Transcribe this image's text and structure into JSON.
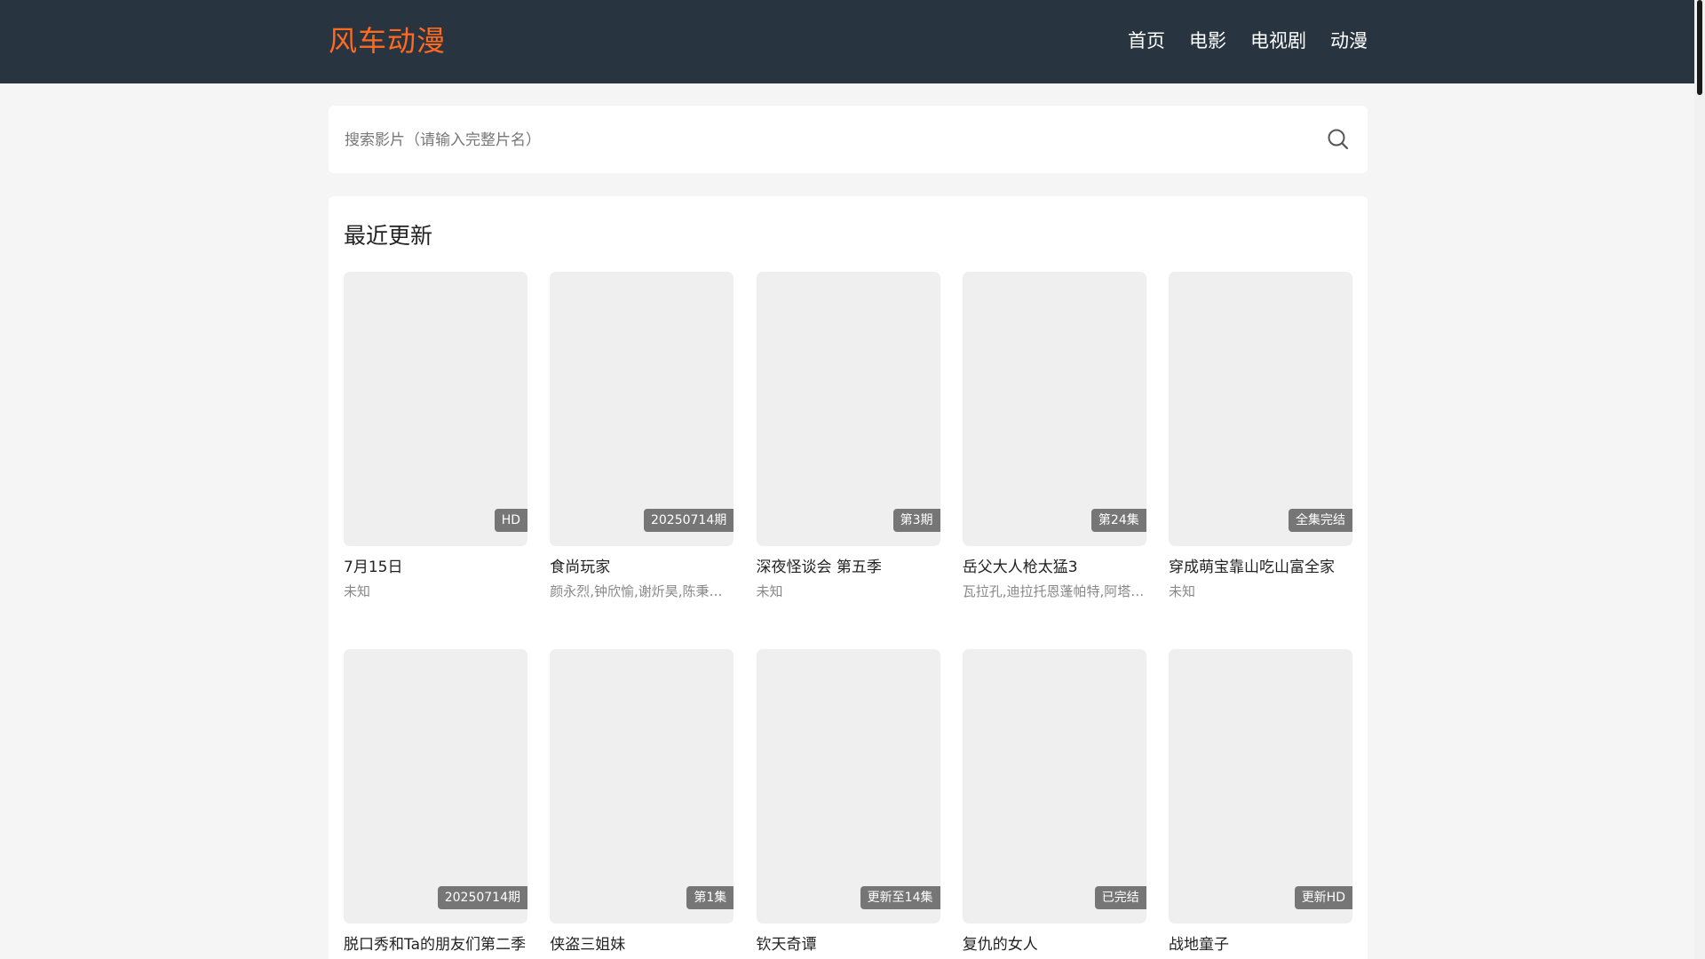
{
  "header": {
    "logo": "风车动漫",
    "nav": [
      "首页",
      "电影",
      "电视剧",
      "动漫"
    ]
  },
  "search": {
    "placeholder": "搜索影片（请输入完整片名）",
    "value": ""
  },
  "section": {
    "title": "最近更新"
  },
  "items": [
    {
      "title": "7月15日",
      "sub": "未知",
      "badge": "HD"
    },
    {
      "title": "食尚玩家",
      "sub": "颜永烈,钟欣愉,谢炘昊,陈秉…",
      "badge": "20250714期"
    },
    {
      "title": "深夜怪谈会 第五季",
      "sub": "未知",
      "badge": "第3期"
    },
    {
      "title": "岳父大人枪太猛3",
      "sub": "瓦拉孔,迪拉托恩蓬帕特,阿塔…",
      "badge": "第24集"
    },
    {
      "title": "穿成萌宝靠山吃山富全家",
      "sub": "未知",
      "badge": "全集完结"
    },
    {
      "title": "脱口秀和Ta的朋友们第二季",
      "sub": "",
      "badge": "20250714期"
    },
    {
      "title": "侠盗三姐妹",
      "sub": "",
      "badge": "第1集"
    },
    {
      "title": "钦天奇谭",
      "sub": "",
      "badge": "更新至14集"
    },
    {
      "title": "复仇的女人",
      "sub": "",
      "badge": "已完结"
    },
    {
      "title": "战地童子",
      "sub": "",
      "badge": "更新HD"
    }
  ],
  "colors": {
    "header_bg": "#283440",
    "logo": "#ff6a1f",
    "page_bg": "#f5f5f5"
  },
  "icons": {
    "search": "search-icon"
  }
}
